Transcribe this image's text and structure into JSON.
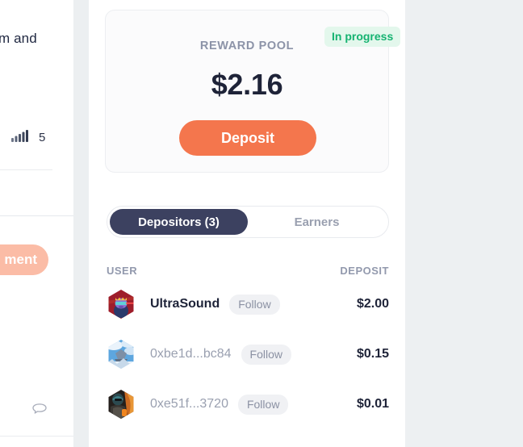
{
  "sidebar": {
    "text_fragment": "m and",
    "stat": {
      "icon": "signal-bars-icon",
      "value": "5"
    },
    "action_pill": {
      "label": "ment",
      "color": "#fbbca6"
    },
    "comment_icon": "comment-bubble-icon"
  },
  "card": {
    "label": "REWARD POOL",
    "amount": "$2.16",
    "deposit_button": "Deposit",
    "status_badge": "In progress",
    "accent_color": "#f4764d",
    "badge_bg": "#e3f7ec",
    "badge_color": "#15b371"
  },
  "tabs": [
    {
      "label": "Depositors (3)",
      "active": true
    },
    {
      "label": "Earners",
      "active": false
    }
  ],
  "list": {
    "columns": {
      "user": "USER",
      "deposit": "DEPOSIT"
    },
    "follow_label": "Follow",
    "rows": [
      {
        "name": "UltraSound",
        "amount": "$2.00",
        "named": true,
        "avatar": "avatar-ultrasound"
      },
      {
        "name": "0xbe1d...bc84",
        "amount": "$0.15",
        "named": false,
        "avatar": "avatar-sky"
      },
      {
        "name": "0xe51f...3720",
        "amount": "$0.01",
        "named": false,
        "avatar": "avatar-figure"
      }
    ]
  }
}
